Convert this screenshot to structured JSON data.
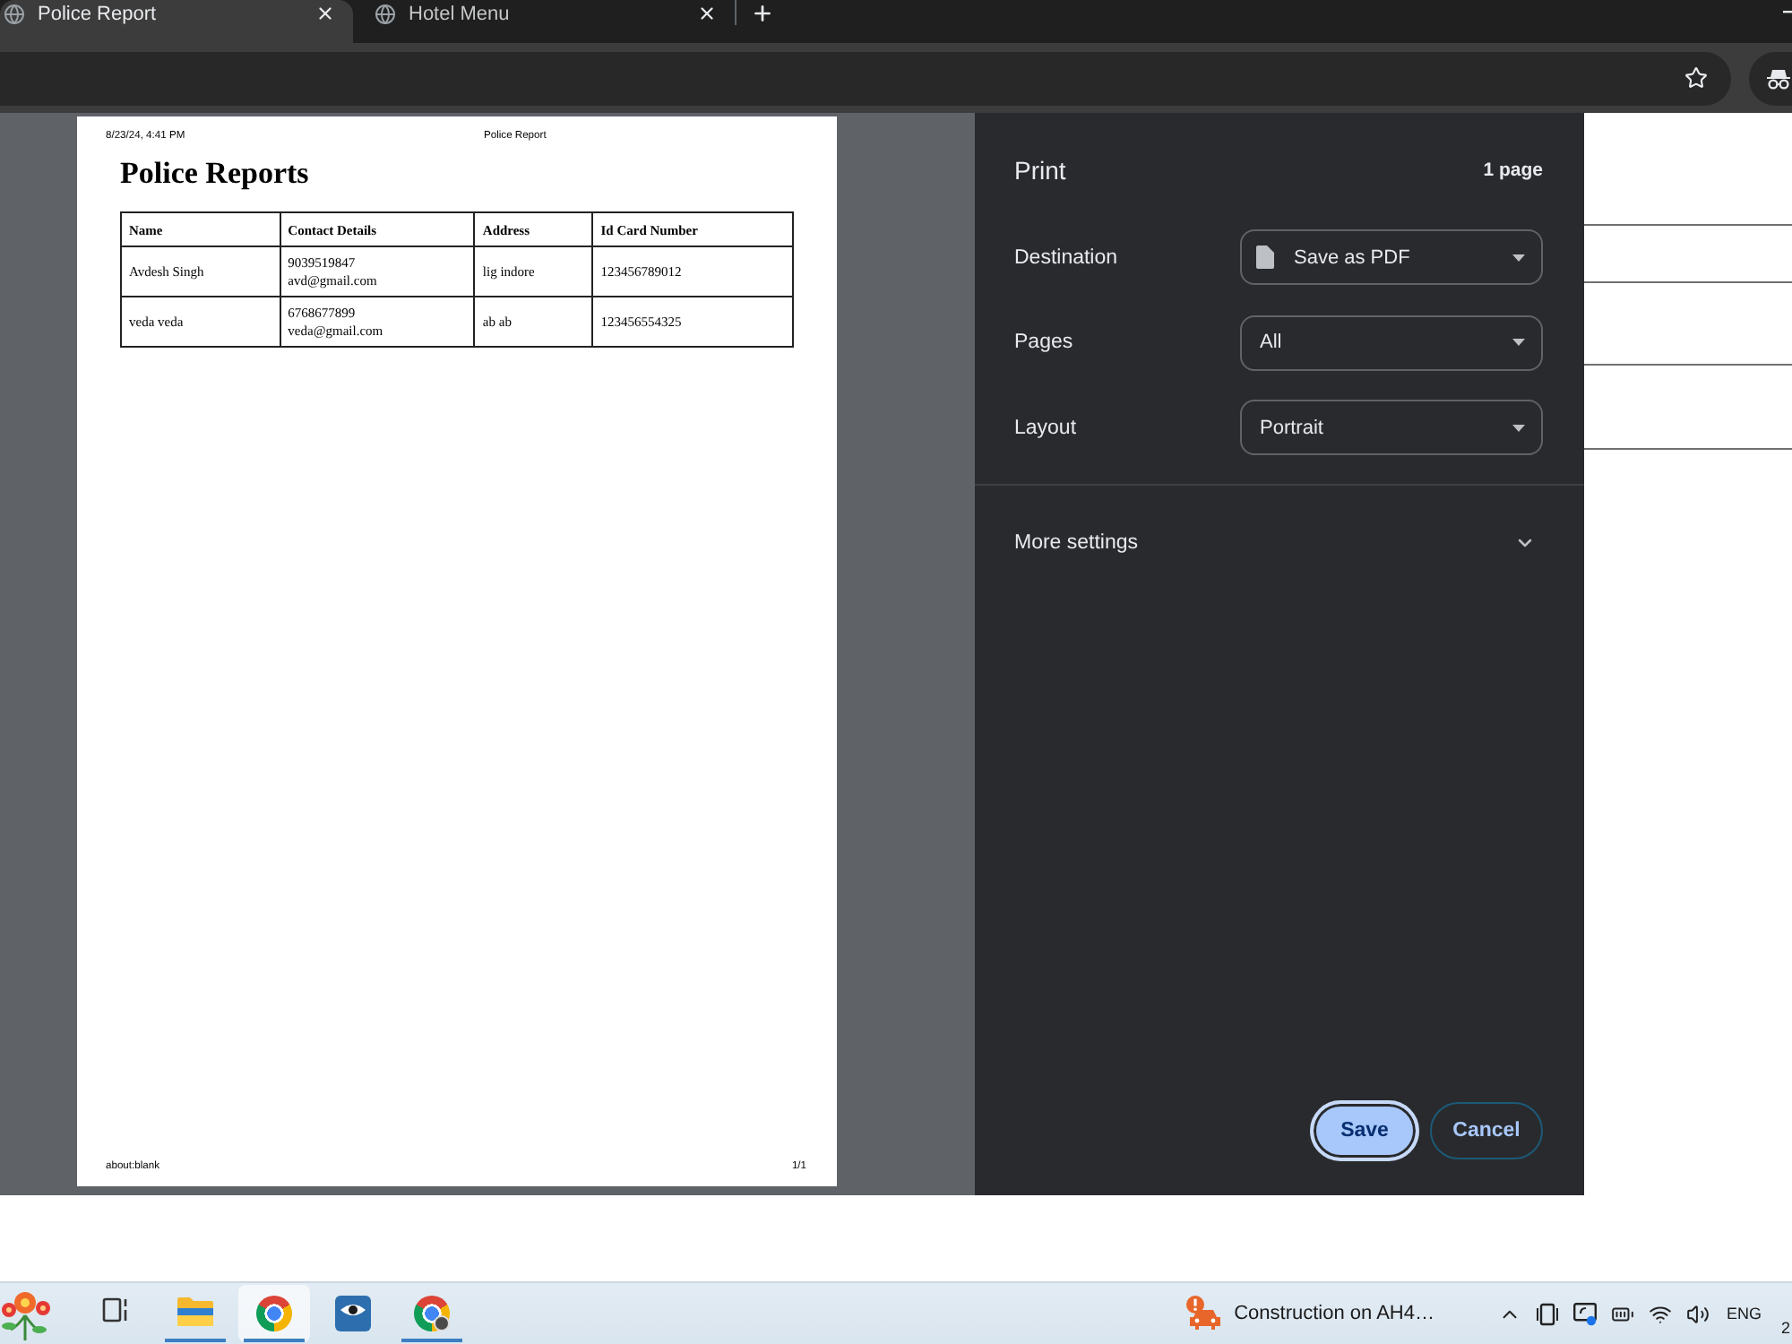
{
  "browser": {
    "tabs": [
      {
        "title": "Police Report",
        "selected": true
      },
      {
        "title": "Hotel Menu",
        "selected": false
      }
    ]
  },
  "preview": {
    "header": {
      "date": "8/23/24, 4:41 PM",
      "title": "Police Report"
    },
    "heading": "Police Reports",
    "table": {
      "columns": [
        "Name",
        "Contact Details",
        "Address",
        "Id Card Number"
      ],
      "rows": [
        [
          "Avdesh Singh",
          "9039519847\navd@gmail.com",
          "lig indore",
          "123456789012"
        ],
        [
          "veda veda",
          "6768677899\nveda@gmail.com",
          "ab ab",
          "123456554325"
        ]
      ]
    },
    "footer": {
      "url": "about:blank",
      "page": "1/1"
    }
  },
  "print_panel": {
    "title": "Print",
    "page_count": "1 page",
    "settings": [
      {
        "kind": "destination",
        "label": "Destination",
        "value": "Save as PDF"
      },
      {
        "kind": "select",
        "label": "Pages",
        "value": "All"
      },
      {
        "kind": "select",
        "label": "Layout",
        "value": "Portrait"
      }
    ],
    "more_settings": {
      "label": "More settings",
      "expanded": false
    },
    "buttons": [
      {
        "kind": "primary",
        "label": "Save",
        "focused": true
      },
      {
        "kind": "secondary",
        "label": "Cancel",
        "focused": false
      }
    ]
  },
  "taskbar": {
    "apps": [
      {
        "kind": "task-view",
        "running": false,
        "selected": false
      },
      {
        "kind": "file-explorer",
        "running": true,
        "selected": false
      },
      {
        "kind": "chrome",
        "running": true,
        "selected": true
      },
      {
        "kind": "eye-app",
        "running": false,
        "selected": false
      },
      {
        "kind": "chrome-profile",
        "running": true,
        "selected": false
      }
    ],
    "news": "Construction on AH4…",
    "language": "ENG",
    "clock": "2"
  }
}
